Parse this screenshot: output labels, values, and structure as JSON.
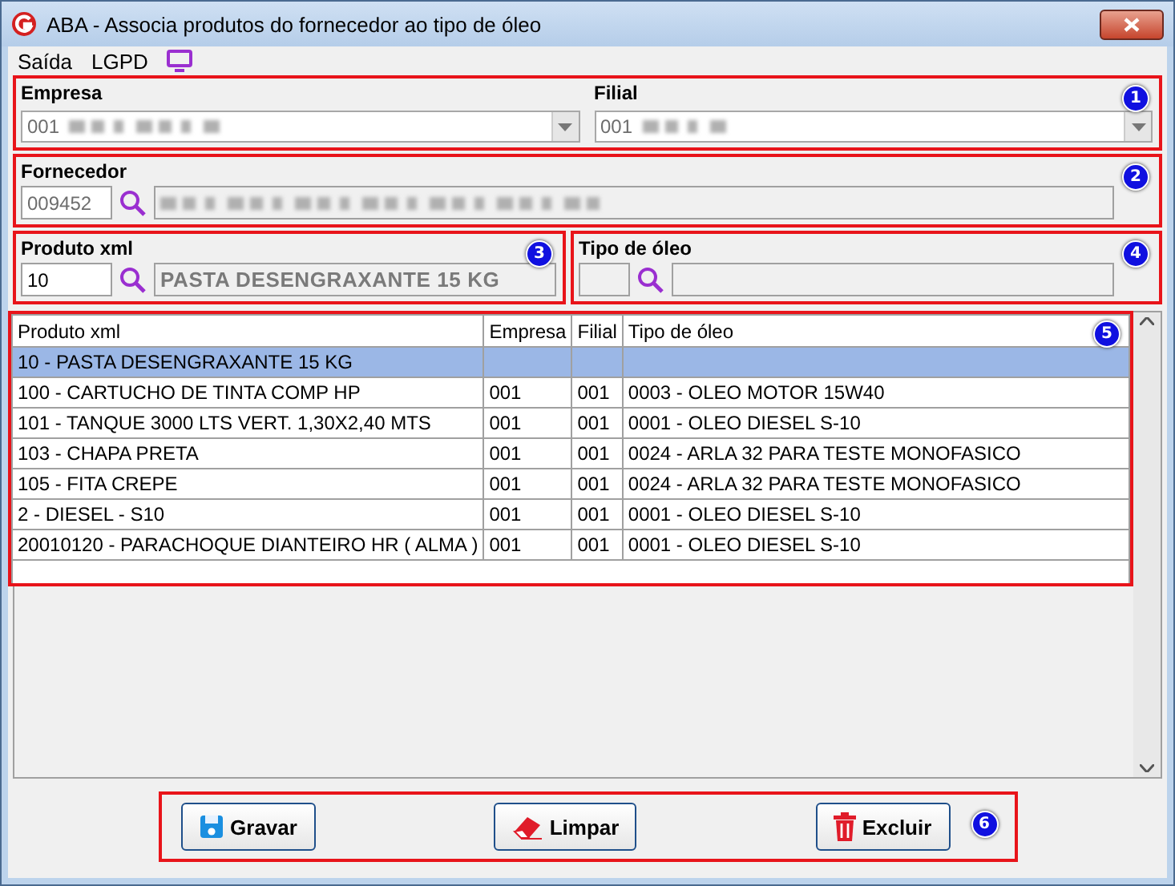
{
  "window": {
    "title": "ABA - Associa produtos do fornecedor ao tipo de óleo"
  },
  "menu": [
    {
      "label": "Saída"
    },
    {
      "label": "LGPD"
    }
  ],
  "company": {
    "marker": "1",
    "empresa": {
      "label": "Empresa",
      "value": "001"
    },
    "filial": {
      "label": "Filial",
      "value": "001"
    }
  },
  "supplier": {
    "marker": "2",
    "label": "Fornecedor",
    "code": "009452"
  },
  "product": {
    "marker": "3",
    "label": "Produto xml",
    "code": "10",
    "description": "PASTA DESENGRAXANTE 15 KG"
  },
  "oil_type": {
    "marker": "4",
    "label": "Tipo de óleo"
  },
  "table": {
    "marker": "5",
    "columns": [
      "Produto xml",
      "Empresa",
      "Filial",
      "Tipo de óleo"
    ],
    "rows": [
      {
        "selected": true,
        "cells": [
          "10 - PASTA DESENGRAXANTE 15 KG",
          "",
          "",
          ""
        ]
      },
      {
        "selected": false,
        "cells": [
          "100 - CARTUCHO DE TINTA COMP HP",
          "001",
          "001",
          "0003 - OLEO MOTOR 15W40"
        ]
      },
      {
        "selected": false,
        "cells": [
          "101 - TANQUE 3000 LTS VERT. 1,30X2,40 MTS",
          "001",
          "001",
          "0001 - OLEO DIESEL S-10"
        ]
      },
      {
        "selected": false,
        "cells": [
          "103 - CHAPA PRETA",
          "001",
          "001",
          "0024 - ARLA 32 PARA TESTE MONOFASICO"
        ]
      },
      {
        "selected": false,
        "cells": [
          "105 - FITA CREPE",
          "001",
          "001",
          "0024 - ARLA 32 PARA TESTE MONOFASICO"
        ]
      },
      {
        "selected": false,
        "cells": [
          "2 - DIESEL - S10",
          "001",
          "001",
          "0001 - OLEO DIESEL S-10"
        ]
      },
      {
        "selected": false,
        "cells": [
          "20010120 - PARACHOQUE DIANTEIRO HR ( ALMA )",
          "001",
          "001",
          "0001 - OLEO DIESEL S-10"
        ]
      }
    ]
  },
  "actions": {
    "marker": "6",
    "buttons": [
      {
        "label": "Gravar",
        "kind": "save"
      },
      {
        "label": "Limpar",
        "kind": "clear"
      },
      {
        "label": "Excluir",
        "kind": "delete"
      }
    ]
  }
}
